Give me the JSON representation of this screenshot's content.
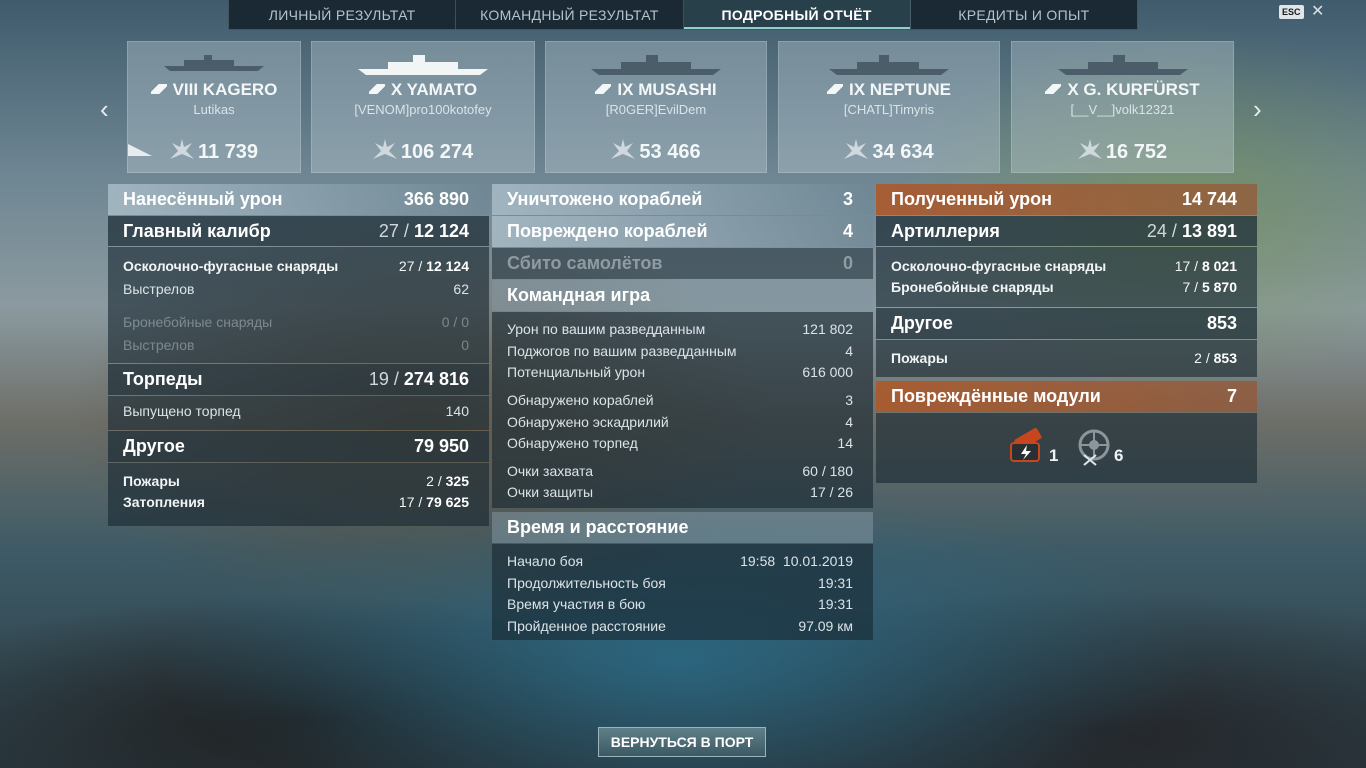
{
  "tabs": [
    "ЛИЧНЫЙ РЕЗУЛЬТАТ",
    "КОМАНДНЫЙ РЕЗУЛЬТАТ",
    "ПОДРОБНЫЙ ОТЧЁТ",
    "КРЕДИТЫ И ОПЫТ"
  ],
  "active_tab_index": 2,
  "esc": {
    "label": "ESC",
    "close": "✕"
  },
  "ships": [
    {
      "tier": "VIII KAGERO",
      "player": "Lutikas",
      "score": "11 739"
    },
    {
      "tier": "X YAMATO",
      "player": "[VENOM]pro100kotofey",
      "score": "106 274"
    },
    {
      "tier": "IX MUSASHI",
      "player": "[R0GER]EvilDem",
      "score": "53 466"
    },
    {
      "tier": "IX NEPTUNE",
      "player": "[CHATL]Timyris",
      "score": "34 634"
    },
    {
      "tier": "X G. KURFÜRST",
      "player": "[__V__]volk12321",
      "score": "16 752"
    }
  ],
  "left": {
    "damage": {
      "label": "Нанесённый урон",
      "value": "366 890"
    },
    "main_battery": {
      "label": "Главный калибр",
      "hits": "27",
      "sep": " / ",
      "value": "12 124"
    },
    "he_shells": {
      "label": "Осколочно-фугасные снаряды",
      "hits": "27",
      "sep": " / ",
      "value": "12 124"
    },
    "he_shots": {
      "label": "Выстрелов",
      "value": "62"
    },
    "ap_shells": {
      "label": "Бронебойные снаряды",
      "value": "0 / 0"
    },
    "ap_shots": {
      "label": "Выстрелов",
      "value": "0"
    },
    "torpedoes": {
      "label": "Торпеды",
      "hits": "19",
      "sep": " / ",
      "value": "274 816"
    },
    "torps_fired": {
      "label": "Выпущено торпед",
      "value": "140"
    },
    "other": {
      "label": "Другое",
      "value": "79 950"
    },
    "fires": {
      "label": "Пожары",
      "hits": "2",
      "sep": " / ",
      "value": "325"
    },
    "floods": {
      "label": "Затопления",
      "hits": "17",
      "sep": " / ",
      "value": "79 625"
    }
  },
  "middle": {
    "destroyed": {
      "label": "Уничтожено кораблей",
      "value": "3"
    },
    "damaged": {
      "label": "Повреждено кораблей",
      "value": "4"
    },
    "planes": {
      "label": "Сбито самолётов",
      "value": "0"
    },
    "team_play": {
      "label": "Командная игра"
    },
    "team_rows": [
      {
        "label": "Урон по вашим разведданным",
        "value": "121 802"
      },
      {
        "label": "Поджогов по вашим разведданным",
        "value": "4"
      },
      {
        "label": "Потенциальный урон",
        "value": "616 000"
      },
      {
        "label": "Обнаружено кораблей",
        "value": "3"
      },
      {
        "label": "Обнаружено эскадрилий",
        "value": "4"
      },
      {
        "label": "Обнаружено торпед",
        "value": "14"
      },
      {
        "label": "Очки захвата",
        "value": "60 / 180"
      },
      {
        "label": "Очки защиты",
        "value": "17 / 26"
      }
    ],
    "time": {
      "label": "Время и расстояние"
    },
    "time_rows": [
      {
        "label": "Начало боя",
        "value": "19:58  10.01.2019"
      },
      {
        "label": "Продолжительность боя",
        "value": "19:31"
      },
      {
        "label": "Время участия в бою",
        "value": "19:31"
      },
      {
        "label": "Пройденное расстояние",
        "value": "97.09 км"
      }
    ]
  },
  "right": {
    "received": {
      "label": "Полученный урон",
      "value": "14 744"
    },
    "artillery": {
      "label": "Артиллерия",
      "hits": "24",
      "sep": " / ",
      "value": "13 891"
    },
    "he": {
      "label": "Осколочно-фугасные снаряды",
      "hits": "17",
      "sep": " / ",
      "value": "8 021"
    },
    "ap": {
      "label": "Бронебойные снаряды",
      "hits": "7",
      "sep": " / ",
      "value": "5 870"
    },
    "other": {
      "label": "Другое",
      "value": "853"
    },
    "fires": {
      "label": "Пожары",
      "hits": "2",
      "sep": " / ",
      "value": "853"
    },
    "modules": {
      "label": "Повреждённые модули",
      "value": "7"
    },
    "module_icons": [
      {
        "icon": "torpedo-tube-damaged-icon",
        "count": "1",
        "color": "#c8461e"
      },
      {
        "icon": "steering-gear-icon",
        "count": "6",
        "color": "#8a969c"
      }
    ]
  },
  "buttons": {
    "port": "ВЕРНУТЬСЯ В ПОРТ"
  }
}
